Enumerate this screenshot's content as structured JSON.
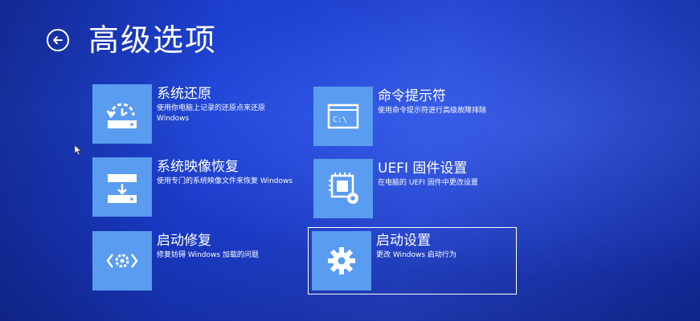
{
  "header": {
    "title": "高级选项"
  },
  "tiles": [
    {
      "title": "系统还原",
      "description": "使用你电脑上记录的还原点来还原 Windows",
      "icon": "system-restore-icon"
    },
    {
      "title": "命令提示符",
      "description": "使用命令提示符进行高级故障排除",
      "icon": "command-prompt-icon"
    },
    {
      "title": "系统映像恢复",
      "description": "使用专门的系统映像文件来恢复 Windows",
      "icon": "system-image-recovery-icon"
    },
    {
      "title": "UEFI 固件设置",
      "description": "在电脑的 UEFI 固件中更改设置",
      "icon": "uefi-firmware-icon"
    },
    {
      "title": "启动修复",
      "description": "修复妨碍 Windows 加载的问题",
      "icon": "startup-repair-icon"
    },
    {
      "title": "启动设置",
      "description": "更改 Windows 启动行为",
      "icon": "startup-settings-gear-icon",
      "selected": true
    }
  ],
  "colors": {
    "background": "#1f45d6",
    "tile_icon_bg": "#5a9cf0",
    "text": "#ffffff"
  }
}
